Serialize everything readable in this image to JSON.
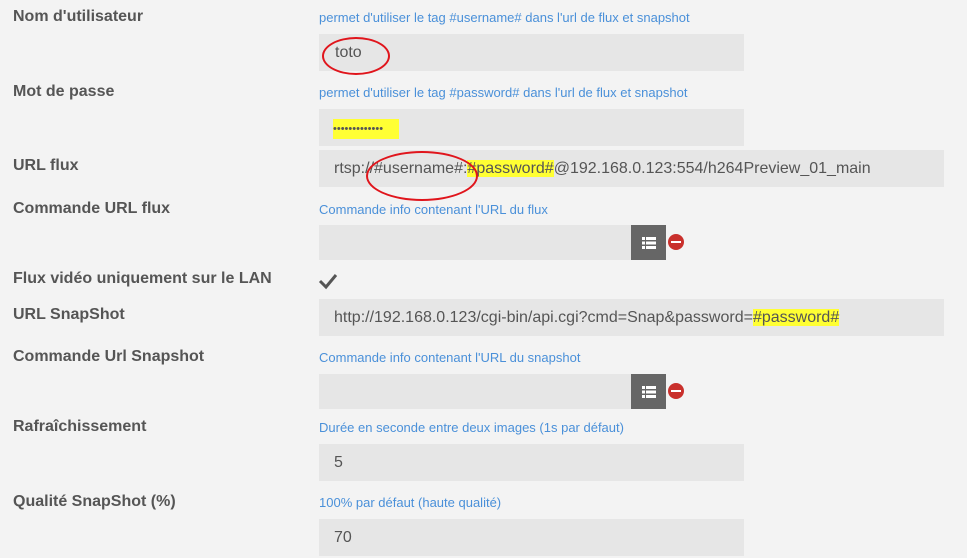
{
  "fields": {
    "username": {
      "label": "Nom d'utilisateur",
      "help": "permet d'utiliser le tag #username# dans l'url de flux et snapshot",
      "value": "toto"
    },
    "password": {
      "label": "Mot de passe",
      "help": "permet d'utiliser le tag #password# dans l'url de flux et snapshot",
      "value": "•••••••••••••"
    },
    "url_flux": {
      "label": "URL flux",
      "value_prefix": "rtsp://",
      "value_user_tag": "#username#",
      "value_sep": ":",
      "value_pass_tag": "#password#",
      "value_suffix": "@192.168.0.123:554/h264Preview_01_main"
    },
    "cmd_url_flux": {
      "label": "Commande URL flux",
      "help": "Commande info contenant l'URL du flux",
      "value": ""
    },
    "lan_only": {
      "label": "Flux vidéo uniquement sur le LAN",
      "checked": true
    },
    "url_snapshot": {
      "label": "URL SnapShot",
      "value_prefix": "http://192.168.0.123/cgi-bin/api.cgi?cmd=Snap&password=",
      "value_pass_tag": "#password#"
    },
    "cmd_url_snapshot": {
      "label": "Commande Url Snapshot",
      "help": "Commande info contenant l'URL du snapshot",
      "value": ""
    },
    "refresh": {
      "label": "Rafraîchissement",
      "help": "Durée en seconde entre deux images (1s par défaut)",
      "value": "5"
    },
    "quality": {
      "label": "Qualité SnapShot (%)",
      "help": "100% par défaut (haute qualité)",
      "value": "70"
    }
  },
  "icons": {
    "list": "list-icon",
    "remove": "remove-icon",
    "check": "checkmark-icon"
  },
  "colors": {
    "help_text": "#4a90d9",
    "highlight": "#ffff33",
    "annotation": "#e0151c",
    "remove": "#c9302c"
  }
}
